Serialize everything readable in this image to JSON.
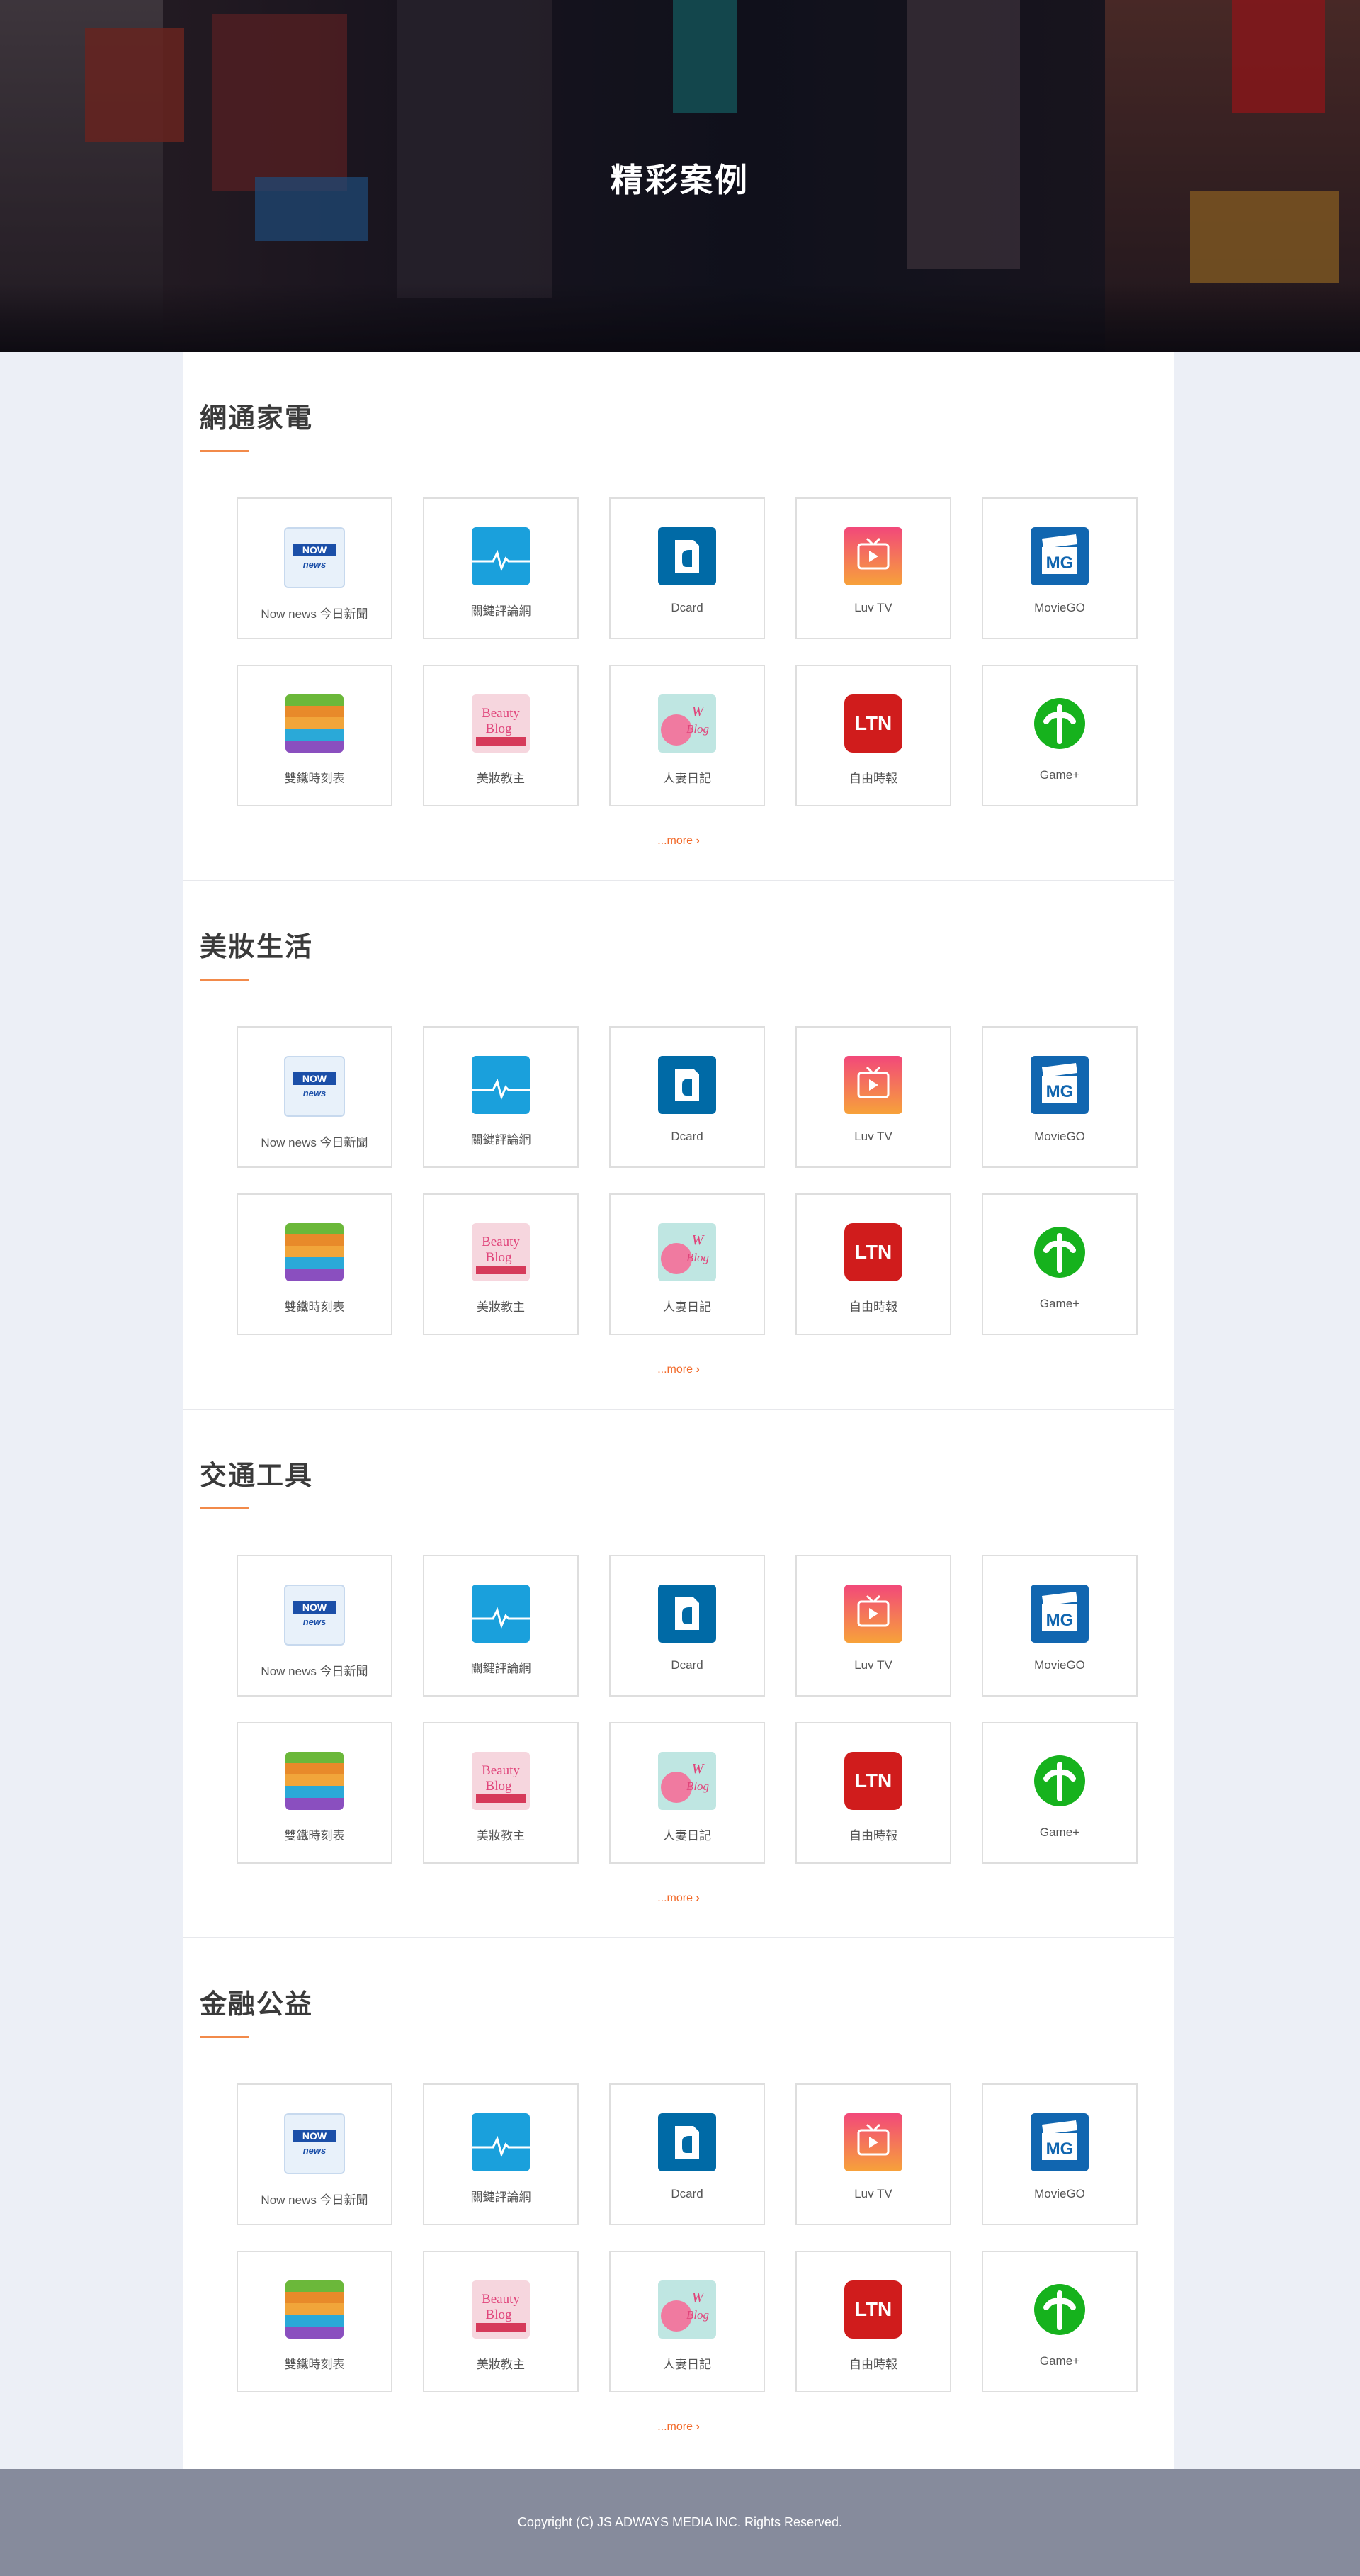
{
  "hero": {
    "title": "精彩案例"
  },
  "sections": [
    {
      "title": "網通家電",
      "more": "...more"
    },
    {
      "title": "美妝生活",
      "more": "...more"
    },
    {
      "title": "交通工具",
      "more": "...more"
    },
    {
      "title": "金融公益",
      "more": "...more"
    }
  ],
  "apps": [
    {
      "label": "Now news 今日新聞",
      "icon": "nownews-icon",
      "icon_text": "NOW news"
    },
    {
      "label": "關鍵評論網",
      "icon": "pulse-icon"
    },
    {
      "label": "Dcard",
      "icon": "dcard-icon"
    },
    {
      "label": "Luv TV",
      "icon": "luvtv-icon"
    },
    {
      "label": "MovieGO",
      "icon": "moviego-icon",
      "icon_text": "MG"
    },
    {
      "label": "雙鐵時刻表",
      "icon": "railway-icon"
    },
    {
      "label": "美妝教主",
      "icon": "beautyblog-icon",
      "icon_text": "Beauty Blog"
    },
    {
      "label": "人妻日記",
      "icon": "wblog-icon",
      "icon_text": "W Blog"
    },
    {
      "label": "自由時報",
      "icon": "ltn-icon",
      "icon_text": "LTN"
    },
    {
      "label": "Game+",
      "icon": "gameplus-icon"
    }
  ],
  "colors": {
    "accent": "#f28a4a",
    "footer": "#868b9c",
    "more_link": "#f26a2a"
  },
  "footer": {
    "copyright": "Copyright (C) JS ADWAYS MEDIA INC. Rights Reserved."
  }
}
